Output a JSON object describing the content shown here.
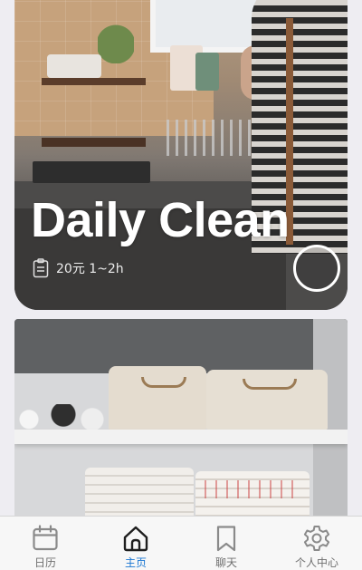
{
  "feed": {
    "cards": [
      {
        "title": "Daily Clean",
        "price_duration": "20元 1~2h",
        "meta_icon": "clipboard-icon",
        "action_icon": "circle-button-icon"
      },
      {
        "title": "",
        "price_duration": ""
      }
    ]
  },
  "tabbar": {
    "active_index": 1,
    "active_color": "#1976d2",
    "inactive_color": "#6f6f6f",
    "tabs": [
      {
        "label": "日历",
        "icon": "calendar-icon"
      },
      {
        "label": "主页",
        "icon": "home-icon"
      },
      {
        "label": "聊天",
        "icon": "bookmark-icon"
      },
      {
        "label": "个人中心",
        "icon": "gear-icon"
      }
    ]
  }
}
